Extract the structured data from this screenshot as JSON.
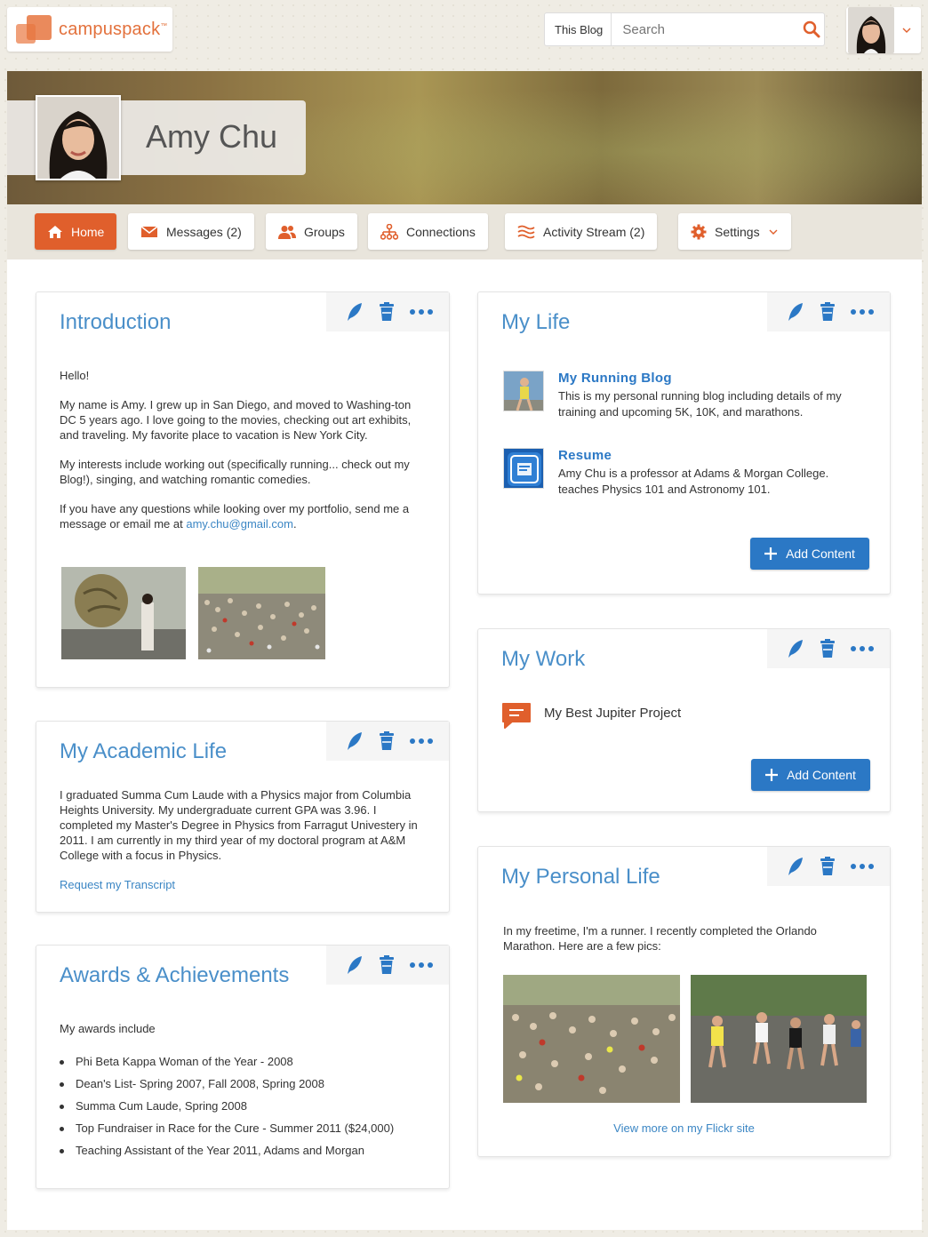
{
  "brand": {
    "name": "campuspack",
    "tm": "™"
  },
  "search": {
    "scope": "This Blog",
    "placeholder": "Search"
  },
  "profile": {
    "name": "Amy Chu"
  },
  "nav": [
    {
      "label": "Home",
      "icon": "home-icon"
    },
    {
      "label": "Messages (2)",
      "icon": "envelope-icon"
    },
    {
      "label": "Groups",
      "icon": "users-icon"
    },
    {
      "label": "Connections",
      "icon": "network-icon"
    },
    {
      "label": "Activity Stream (2)",
      "icon": "activity-icon"
    },
    {
      "label": "Settings",
      "icon": "gear-icon"
    }
  ],
  "intro": {
    "title": "Introduction",
    "greeting": "Hello!",
    "p1": "My name is Amy.  I grew up in San Diego, and moved to Washing-ton DC 5 years ago.  I love going to the movies, checking out art exhibits, and traveling.  My favorite place to vacation is New York City.",
    "p2": "My interests include working out (specifically running... check out my Blog!), singing, and watching romantic comedies.",
    "p3": "If you have any questions while looking over my portfolio, send me a message or email me at",
    "email": "amy.chu@gmail.com",
    "p3_end": "."
  },
  "academic": {
    "title": "My Academic Life",
    "text": "I graduated Summa Cum Laude with a Physics major from Columbia Heights University.  My undergraduate current GPA was 3.96.  I completed my Master's Degree in Physics from Farragut Univestery in 2011. I am currently in my third year of my doctoral program at A&M College with a focus in Physics.",
    "link": "Request my Transcript"
  },
  "awards": {
    "title": "Awards & Achievements",
    "intro": "My awards include",
    "items": [
      "Phi Beta Kappa Woman of the Year - 2008",
      "Dean's List- Spring 2007, Fall 2008, Spring 2008",
      "Summa Cum Laude, Spring 2008",
      "Top Fundraiser in Race for the Cure - Summer 2011 ($24,000)",
      "Teaching Assistant of the Year 2011, Adams and Morgan"
    ]
  },
  "mylife": {
    "title": "My Life",
    "items": [
      {
        "title": "My Running Blog",
        "desc": "This is my personal running blog including details of my training and upcoming 5K, 10K, and marathons."
      },
      {
        "title": "Resume",
        "desc": "Amy Chu is a professor at Adams & Morgan College. teaches Physics 101 and Astronomy 101."
      }
    ],
    "add_label": "Add Content"
  },
  "mywork": {
    "title": "My Work",
    "item": "My Best Jupiter Project",
    "add_label": "Add Content"
  },
  "personal": {
    "title": "My Personal Life",
    "text": "In my freetime, I'm a runner.  I recently completed the Orlando Marathon.  Here are a few pics:",
    "link": "View more on my Flickr site"
  },
  "colors": {
    "accent": "#e05f2c",
    "link": "#2b78c5",
    "title": "#4a8fc9"
  }
}
